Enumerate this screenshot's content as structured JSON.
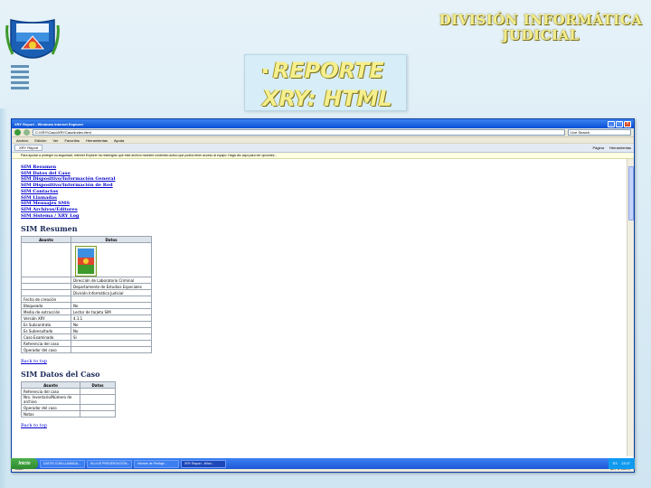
{
  "slide": {
    "org_line1": "DIVISIÓN INFORMÁTICA",
    "org_line2": "JUDICIAL",
    "title_line1": "REPORTE",
    "title_line2": "XRY: HTML",
    "bullet": "▪"
  },
  "browser": {
    "window_title": "XRY Report - Windows Internet Explorer",
    "address": "C:\\XRY\\Caso\\XRYCaso\\index.html",
    "search_placeholder": "Live Search",
    "menu": [
      "Archivo",
      "Edición",
      "Ver",
      "Favoritos",
      "Herramientas",
      "Ayuda"
    ],
    "tab_label": "XRY Report",
    "tools": [
      "Página",
      "Herramientas"
    ],
    "infobar": "Para ayudar a proteger su seguridad, Internet Explorer ha restringido que este archivo muestre contenido activo que podría tener acceso al equipo. Haga clic aquí para ver opciones...",
    "status_left": "Listo",
    "status_right": "Mi PC     100%"
  },
  "report": {
    "toc": [
      "SIM Resumen",
      "SIM Datos del Caso",
      "SIM Dispositivo/Información General",
      "SIM Dispositivo/Información de Red",
      "SIM Contactos",
      "SIM Llamadas",
      "SIM Mensajes SMS",
      "SIM Archivos/Editores",
      "SIM Sistema / XRY Log"
    ],
    "summary_title": "SIM Resumen",
    "summary_headers": [
      "Asunto",
      "Datos"
    ],
    "summary_rows": [
      [
        "",
        "Dirección de Laboratorio Criminal"
      ],
      [
        "",
        "Departamento de Estudios Especiales"
      ],
      [
        "",
        "División Informática Judicial"
      ],
      [
        "Fecha de creación",
        ""
      ],
      [
        "Bloqueado",
        "No"
      ],
      [
        "Medio de extracción",
        "Lector de tarjeta SIM"
      ],
      [
        "Versión XRY",
        "4.1.1"
      ],
      [
        "Es Subcontrato",
        "No"
      ],
      [
        "Es Subresultado",
        "No"
      ],
      [
        "Caso Examinado",
        "Sí"
      ],
      [
        "Referencia del caso",
        ""
      ],
      [
        "Operador del caso",
        ""
      ]
    ],
    "back_link": "Back to top",
    "case_title": "SIM Datos del Caso",
    "case_headers": [
      "Asunto",
      "Datos"
    ],
    "case_rows": [
      [
        "Referencia del caso",
        ""
      ],
      [
        "Nro. Inventario/Número de archivo",
        ""
      ],
      [
        "Operador del caso",
        ""
      ],
      [
        "Notas",
        ""
      ]
    ]
  },
  "taskbar": {
    "start": "Inicio",
    "tasks": [
      "DATOS COM.LLAMADA...",
      "IN LIVE PRESENTACIÓN...",
      "Informe de Peritaje...",
      "XRY Report - Wind..."
    ],
    "clock": "13:37",
    "lang": "ES"
  },
  "colors": {
    "accent_yellow": "#f4ee8a",
    "xp_blue": "#1e57d6",
    "link_blue": "#0000cc"
  }
}
